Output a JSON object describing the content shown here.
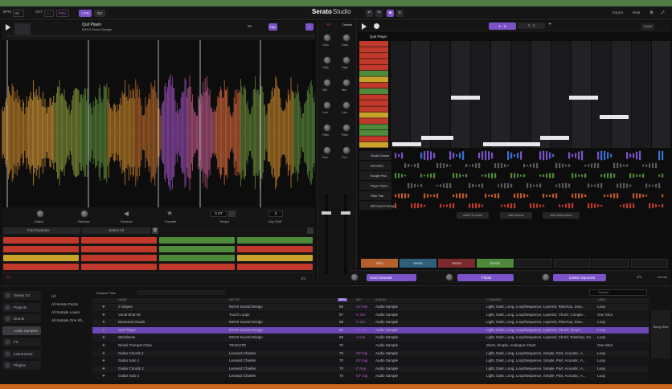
{
  "topbar": {
    "bpm_label": "BPM",
    "bpm_value": "90",
    "key_label": "KEY",
    "key_value": "F#m",
    "add_label": "+ FX",
    "dj_label": "DJ",
    "brand": "Serato",
    "brand2": "Studio",
    "export_label": "Export",
    "help_label": "Help"
  },
  "deck": {
    "track_name": "Quit Playin",
    "artist": "MSXII Sound Design",
    "bpm": "90",
    "key": "F#m",
    "time": "0:00"
  },
  "controls": {
    "attack": "Attack",
    "release": "Release",
    "reverse": "Reverse",
    "favorite": "Favorite",
    "semitones": "0 ST",
    "tempo_label": "Tempo",
    "key_shift_label": "Key Shift",
    "find_samples": "Find Samples",
    "select_all": "Select All"
  },
  "mixer": {
    "labels": [
      "Gain",
      "High",
      "Mid",
      "Low",
      "Filter",
      "Pan"
    ],
    "left_channel": "FX",
    "right_channel": "Drums"
  },
  "sequencer": {
    "tab_1": "1 - 2",
    "tab_2": "3 - 4",
    "track_label": "Quit Playin",
    "close_label": "Close"
  },
  "instrument_lanes": [
    {
      "name": "Studio Drums",
      "color": "#7b53c9"
    },
    {
      "name": "808 Bass",
      "color": "#5a5a5e"
    },
    {
      "name": "Boogie Pad",
      "color": "#4f8a3b"
    },
    {
      "name": "Player Piano",
      "color": "#5a5a5e"
    },
    {
      "name": "Filter Pad",
      "color": "#c05a2b"
    },
    {
      "name": "808 Sound Design",
      "color": "#c0392b"
    }
  ],
  "lane_buttons": {
    "add_fx": "Add FX chain",
    "add_scene": "Add Scene",
    "add_instrument": "Add instrument"
  },
  "scenes": [
    {
      "label": "Intro",
      "color": "#b5602c"
    },
    {
      "label": "Verse",
      "color": "#2e5f7a"
    },
    {
      "label": "Verse",
      "color": "#7a2a2a"
    },
    {
      "label": "Break",
      "color": "#4f8a3b"
    }
  ],
  "fx_bar": {
    "fx1": "Hard Saturate",
    "fx2": "Flutter",
    "fx3": "Limiter Squeeze",
    "song_view": "Song View"
  },
  "browser": {
    "sidebar": [
      "Serato DJ Library",
      "Projects",
      "Drums",
      "Audio Samples",
      "FX",
      "Instruments",
      "Plugins"
    ],
    "tree": [
      "All",
      "All Serato Packs",
      "All Sample Loops",
      "All Sample One Sh..."
    ],
    "analyze_label": "Analyze Files",
    "search_placeholder": "Search",
    "headers": [
      "NAME",
      "ARTIST",
      "BPM",
      "KEY",
      "ALBUM",
      "COMMENT",
      "LABEL"
    ],
    "rows": [
      {
        "name": "2 Stripes",
        "artist": "MSXII Sound Design",
        "bpm": "85",
        "key": "C# min",
        "album": "Audio Sample",
        "comment": "Light, Dark, Long, Loop/Sequence, Layered, Riser/Up, Dow...",
        "label": "Loop",
        "selected": false
      },
      {
        "name": "Vocal Shot 08",
        "artist": "Touch Loops",
        "bpm": "87",
        "key": "C min",
        "album": "Audio Sample",
        "comment": "Light, Dark, Long, Loop/Sequence, Layered, Chord, Comple...",
        "label": "One Shot",
        "selected": false
      },
      {
        "name": "Diamond Clouds",
        "artist": "MSXII Sound Design",
        "bpm": "88",
        "key": "C min",
        "album": "Audio Sample",
        "comment": "Light, Dark, Long, Loop/Sequence, Layered, Riser/Up, Dow...",
        "label": "Loop",
        "selected": false
      },
      {
        "name": "Quit Playin",
        "artist": "MSXII Sound Design",
        "bpm": "90",
        "key": "F# min",
        "album": "Audio Sample",
        "comment": "Light, Dark, Long, Loop/Sequence, Layered, Chord, Simpl...",
        "label": "Loop",
        "selected": true
      },
      {
        "name": "Weirdness",
        "artist": "MSXII Sound Design",
        "bpm": "68",
        "key": "A min",
        "album": "Audio Sample",
        "comment": "Light, Dark, Long, Loop/Sequence, Layered, Chord, Riser/Up, Do...",
        "label": "Loop",
        "selected": false
      },
      {
        "name": "Nickel Trumpet Chas",
        "artist": "TRAKSTR",
        "bpm": "70",
        "key": "",
        "album": "Audio Sample",
        "comment": "Short, Simple, Analogue Chant",
        "label": "One Shot",
        "selected": false
      },
      {
        "name": "Guitar Chords 1",
        "artist": "Leonard Charles",
        "bpm": "70",
        "key": "C# maj",
        "album": "Audio Sample",
        "comment": "Light, Dark, Long, Loop/Sequence, Simple, Part, Acoustic, A...",
        "label": "Loop",
        "selected": false
      },
      {
        "name": "Guitar Solo 1",
        "artist": "Leonard Charles",
        "bpm": "70",
        "key": "C# maj",
        "album": "Audio Sample",
        "comment": "Light, Dark, Long, Loop/Sequence, Simple, Part, Acoustic, A...",
        "label": "Loop",
        "selected": false
      },
      {
        "name": "Guitar Chords 2",
        "artist": "Leonard Charles",
        "bpm": "70",
        "key": "C maj",
        "album": "Audio Sample",
        "comment": "Light, Dark, Long, Loop/Sequence, Simple, Part, Acoustic, A...",
        "label": "Loop",
        "selected": false
      },
      {
        "name": "Guitar Solo 2",
        "artist": "Leonard Charles",
        "bpm": "70",
        "key": "C# maj",
        "album": "Audio Sample",
        "comment": "Light, Dark, Long, Loop/Sequence, Simple, Part, Acoustic, A...",
        "label": "Loop",
        "selected": false
      }
    ]
  },
  "colors": {
    "accent": "#7b53c9",
    "green": "#4f8a3b",
    "red": "#c0392b",
    "orange": "#c05a2b"
  }
}
